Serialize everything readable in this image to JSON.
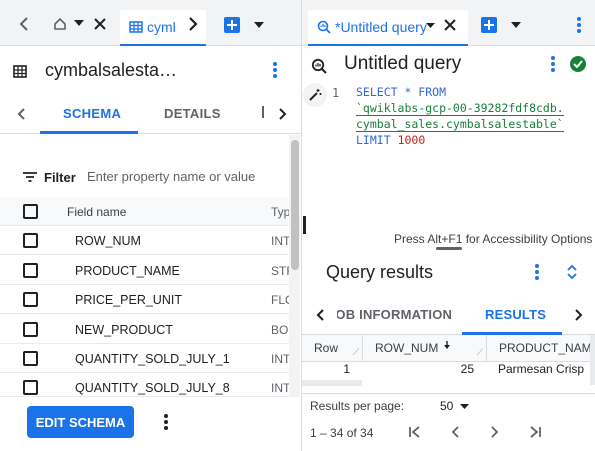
{
  "left_pane": {
    "tab_label": "cymbalsalestable",
    "title": "cymbalsalesta…",
    "subtabs": [
      "SCHEMA",
      "DETAILS"
    ],
    "filter": {
      "label": "Filter",
      "placeholder": "Enter property name or value"
    },
    "table": {
      "header": {
        "name": "Field name",
        "type": "Type"
      },
      "rows": [
        {
          "name": "ROW_NUM",
          "type": "INTEGER"
        },
        {
          "name": "PRODUCT_NAME",
          "type": "STRING"
        },
        {
          "name": "PRICE_PER_UNIT",
          "type": "FLOAT"
        },
        {
          "name": "NEW_PRODUCT",
          "type": "BOOLEAN"
        },
        {
          "name": "QUANTITY_SOLD_JULY_1",
          "type": "INTEGER"
        },
        {
          "name": "QUANTITY_SOLD_JULY_8",
          "type": "INTEGER"
        }
      ]
    },
    "edit_schema_label": "EDIT SCHEMA"
  },
  "right_pane": {
    "tab_label": "*Untitled query",
    "title": "Untitled query",
    "editor": {
      "line_number": "1",
      "line1": "SELECT * FROM",
      "line2": "`qwiklabs-gcp-00-39282fdf8cdb.",
      "line3": "cymbal_sales.cymbalsalestable`",
      "line4_kw": "LIMIT",
      "line4_num": "1000",
      "accessibility_hint": "Press Alt+F1 for Accessibility Options"
    },
    "results": {
      "title": "Query results",
      "tabs": [
        "JOB INFORMATION",
        "RESULTS"
      ],
      "columns": [
        "Row",
        "ROW_NUM",
        "PRODUCT_NAME"
      ],
      "rows": [
        {
          "row": "1",
          "row_num": "25",
          "product_name": "Parmesan Crisp"
        }
      ],
      "rows_per_page_label": "Results per page:",
      "rows_per_page": "50",
      "range": "1 – 34 of 34"
    }
  },
  "colors": {
    "accent": "#1a73e8",
    "success": "#188038",
    "number": "#c5221f"
  }
}
